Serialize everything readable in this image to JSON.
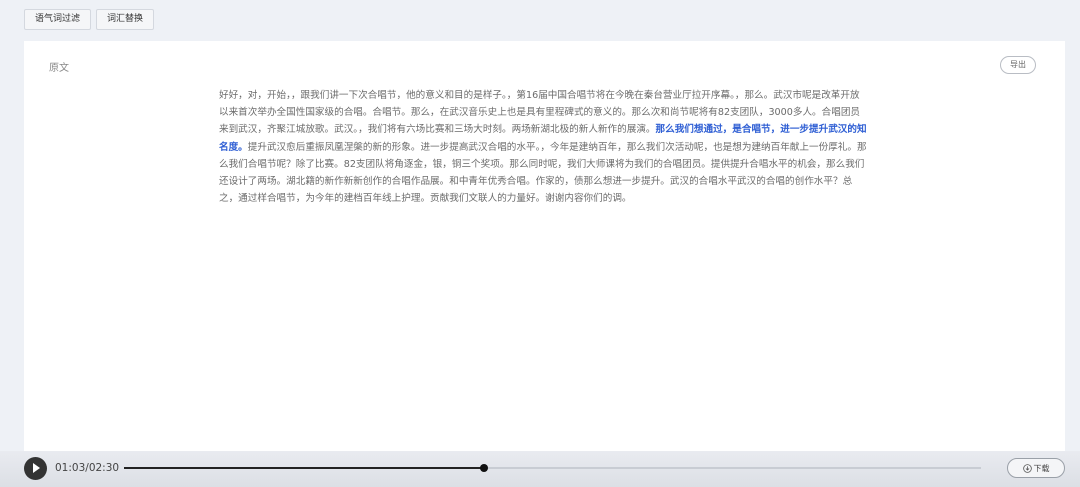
{
  "toolbar": {
    "filter_label": "语气词过滤",
    "replace_label": "词汇替换"
  },
  "panel": {
    "label": "原文",
    "export_label": "导出",
    "paragraph": {
      "before": "好好，对，开始，，跟我们讲一下次合唱节，他的意义和目的是样子。，第16届中国合唱节将在今晚在秦台营业厅拉开序幕。，那么。武汉市呢是改革开放以来首次举办全国性国家级的合唱。合唱节。那么，在武汉音乐史上也是具有里程碑式的意义的。那么次和尚节呢将有82支团队，3000多人。合唱团员来到武汉，齐聚江城放歌。武汉。，我们将有六场比赛和三场大时刻。两场新湖北极的新人新作的展演。",
      "highlight": "那么我们想通过，是合唱节，进一步提升武汉的知名度。",
      "after": "提升武汉愈后重振凤凰涅槃的新的形象。进一步提高武汉合唱的水平。，今年是建纳百年，那么我们次活动呢，也是想为建纳百年献上一份厚礼。那么我们合唱节呢？除了比赛。82支团队将角逐金，银，铜三个奖项。那么同时呢，我们大师课将为我们的合唱团员。提供提升合唱水平的机会，那么我们还设计了两场。湖北籍的新作新新创作的合唱作品展。和中青年优秀合唱。作家的，债那么想进一步提升。武汉的合唱水平武汉的合唱的创作水平？总之，通过样合唱节，为今年的建档百年线上护理。贡献我们文联人的力量好。谢谢内容你们的调。"
    }
  },
  "player": {
    "current_time": "01:03",
    "separator": "/",
    "total_time": "02:30",
    "progress": 0.42,
    "download_label": "下载",
    "play_icon": "play-icon",
    "download_icon": "download-icon"
  }
}
